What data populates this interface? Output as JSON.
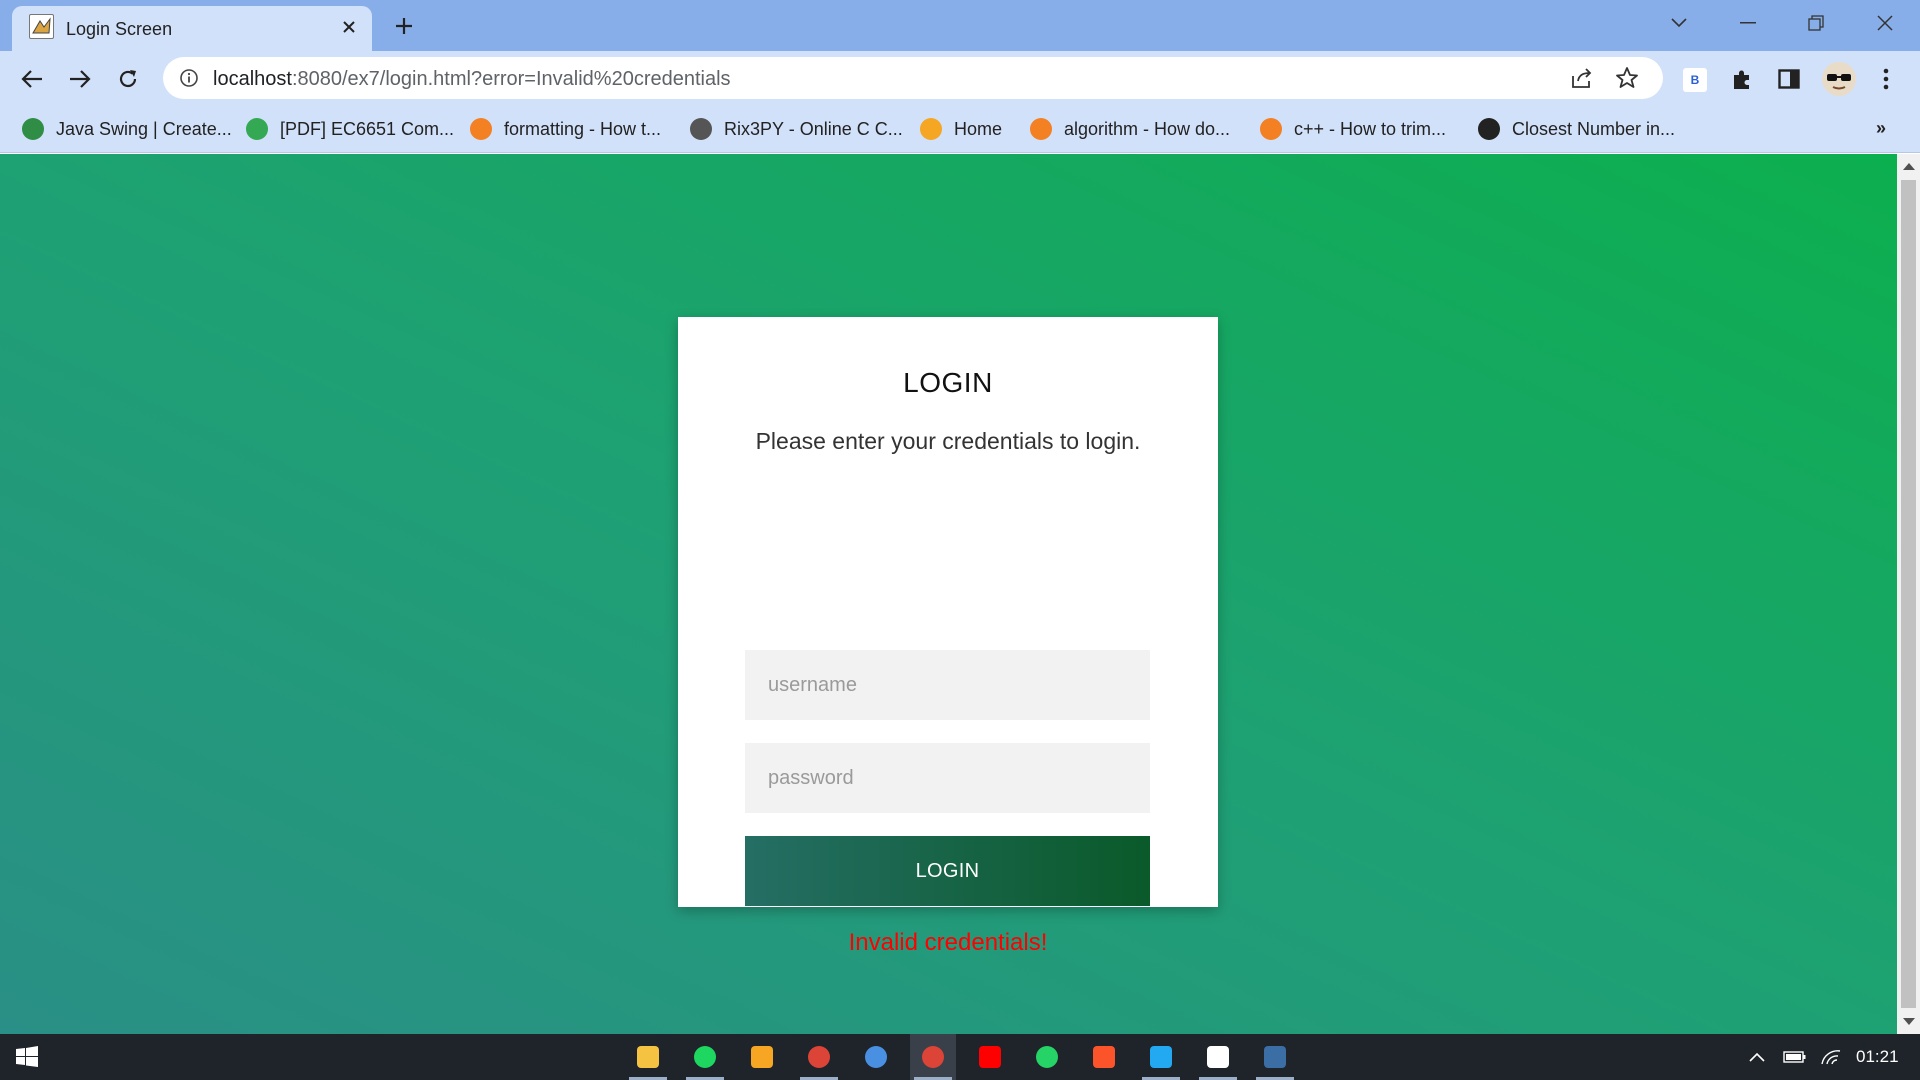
{
  "browser": {
    "tab_title": "Login Screen",
    "url_host": "localhost",
    "url_rest": ":8080/ex7/login.html?error=Invalid%20credentials",
    "bookmarks": [
      {
        "label": "Java Swing | Create...",
        "icon": "geeksforgeeks-icon",
        "color": "#2f8d46"
      },
      {
        "label": "[PDF] EC6651 Com...",
        "icon": "globe-colorful-icon",
        "color": "#34a853"
      },
      {
        "label": "formatting - How t...",
        "icon": "stackoverflow-icon",
        "color": "#f48024"
      },
      {
        "label": "Rix3PY - Online C C...",
        "icon": "ideone-icon",
        "color": "#555555"
      },
      {
        "label": "Home",
        "icon": "box-icon",
        "color": "#f5a623"
      },
      {
        "label": "algorithm - How do...",
        "icon": "stackoverflow-icon",
        "color": "#f48024"
      },
      {
        "label": "c++ - How to trim...",
        "icon": "stackoverflow-icon",
        "color": "#f48024"
      },
      {
        "label": "Closest Number in...",
        "icon": "globe-dark-icon",
        "color": "#222222"
      }
    ],
    "bookmarks_more": "»"
  },
  "login": {
    "title": "LOGIN",
    "subtitle": "Please enter your credentials to login.",
    "username_placeholder": "username",
    "password_placeholder": "password",
    "button_label": "LOGIN",
    "error_message": "Invalid credentials!"
  },
  "taskbar": {
    "clock": "01:21",
    "apps": [
      "file-explorer-icon",
      "spotify-icon",
      "matlab-icon",
      "chrome-icon",
      "spotify-alt-icon",
      "chrome-active-icon",
      "youtube-icon",
      "whatsapp-icon",
      "brave-icon",
      "vscode-icon",
      "settings-icon",
      "terminal-icon"
    ]
  },
  "colors": {
    "accent_tab": "#87aee8",
    "toolbar": "#d2e1fa",
    "error": "#ff0000",
    "button_start": "#246e64",
    "button_end": "#0a5a2a"
  }
}
